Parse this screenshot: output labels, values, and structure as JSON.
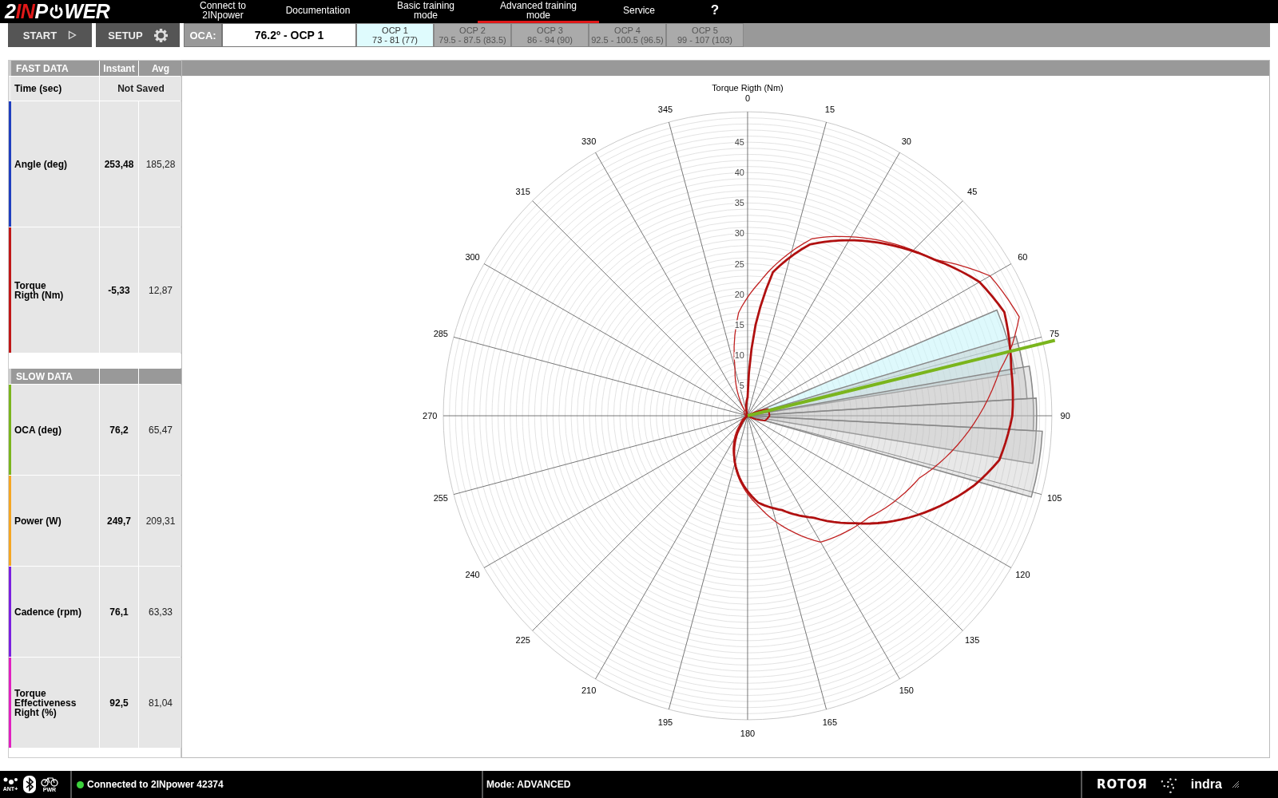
{
  "logo": {
    "prefix": "2",
    "accent": "IN",
    "before_icon": "P",
    "after_icon": "WER"
  },
  "nav": [
    {
      "label": "Connect to\n2INpower",
      "selected": false
    },
    {
      "label": "Documentation",
      "selected": false
    },
    {
      "label": "Basic training\nmode",
      "selected": false
    },
    {
      "label": "Advanced training\nmode",
      "selected": true
    },
    {
      "label": "Service",
      "selected": false
    },
    {
      "label": "?",
      "selected": false
    }
  ],
  "toolbar": {
    "start": "START",
    "setup": "SETUP",
    "oca_label": "OCA:",
    "oca_value": "76.2º - OCP 1",
    "ocp_tabs": [
      {
        "name": "OCP 1",
        "range": "73 - 81 (77)",
        "selected": true
      },
      {
        "name": "OCP 2",
        "range": "79.5 - 87.5 (83.5)",
        "selected": false
      },
      {
        "name": "OCP 3",
        "range": "86 - 94 (90)",
        "selected": false
      },
      {
        "name": "OCP 4",
        "range": "92.5 - 100.5 (96.5)",
        "selected": false
      },
      {
        "name": "OCP 5",
        "range": "99 - 107 (103)",
        "selected": false
      }
    ]
  },
  "fast_data": {
    "header": [
      "FAST DATA",
      "Instant",
      "Avg"
    ],
    "time": {
      "label": "Time (sec)",
      "value": "Not Saved"
    },
    "rows": [
      {
        "label": "Angle (deg)",
        "instant": "253,48",
        "avg": "185,28",
        "color": "#1f3fbf"
      },
      {
        "label": "Torque\nRigth (Nm)",
        "instant": "-5,33",
        "avg": "12,87",
        "color": "#c01818"
      }
    ]
  },
  "slow_data": {
    "header": [
      "SLOW DATA"
    ],
    "rows": [
      {
        "label": "OCA (deg)",
        "instant": "76,2",
        "avg": "65,47",
        "color": "#7ab51d"
      },
      {
        "label": "Power (W)",
        "instant": "249,7",
        "avg": "209,31",
        "color": "#f5a623"
      },
      {
        "label": "Cadence (rpm)",
        "instant": "76,1",
        "avg": "63,33",
        "color": "#7a1fe0"
      },
      {
        "label": "Torque\nEffectiveness\nRight (%)",
        "instant": "92,5",
        "avg": "81,04",
        "color": "#e020c0"
      }
    ]
  },
  "chart": {
    "title": "Torque Rigth (Nm)",
    "angle_labels": [
      "0",
      "15",
      "30",
      "45",
      "60",
      "75",
      "90",
      "105",
      "120",
      "135",
      "150",
      "165",
      "180",
      "195",
      "210",
      "225",
      "240",
      "255",
      "270",
      "285",
      "300",
      "315",
      "330",
      "345"
    ],
    "radial_labels": [
      "45",
      "40",
      "35",
      "30",
      "25",
      "20",
      "15",
      "10",
      "5"
    ]
  },
  "status_bar": {
    "ant_label": "ANT+",
    "pwr_label": "PWR",
    "connection": "Connected to 2INpower 42374",
    "connected": true,
    "mode": "Mode: ADVANCED",
    "brand": "ROTOЯ",
    "partner": "indra"
  }
}
